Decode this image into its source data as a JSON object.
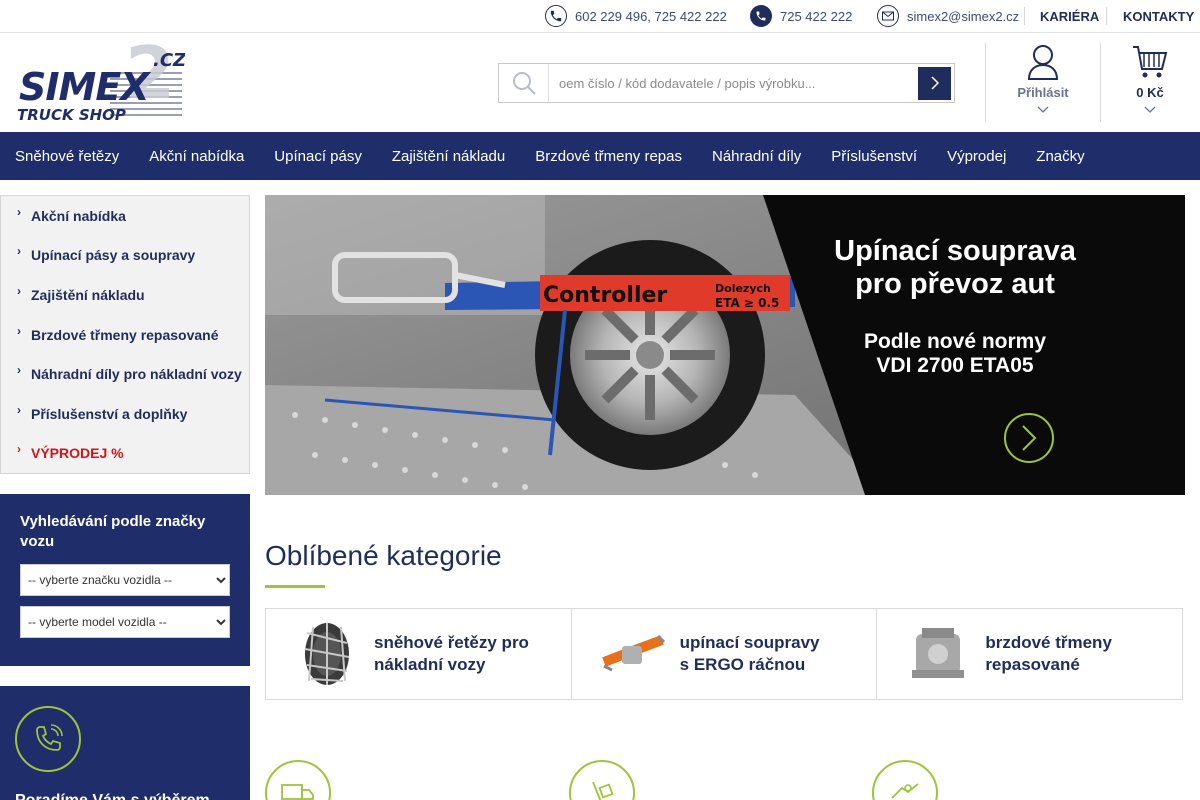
{
  "topbar": {
    "phones": "602 229 496, 725 422 222",
    "whatsapp": "725 422 222",
    "email": "simex2@simex2.cz",
    "links": [
      "KARIÉRA",
      "KONTAKTY"
    ],
    "icons": [
      "phone-icon",
      "whatsapp-icon",
      "mail-icon"
    ]
  },
  "header": {
    "logo_main": "SIMEX",
    "logo_tld": ".CZ",
    "logo_sub": "TRUCK SHOP",
    "logo_num": "2",
    "search_placeholder": "oem číslo / kód dodavatele / popis výrobku...",
    "login_label": "Přihlásit",
    "cart_label": "0 Kč"
  },
  "nav": {
    "items": [
      "Sněhové řetězy",
      "Akční nabídka",
      "Upínací pásy",
      "Zajištění nákladu",
      "Brzdové třmeny repas",
      "Náhradní díly",
      "Příslušenství",
      "Výprodej",
      "Značky"
    ]
  },
  "sidebar": {
    "categories": [
      "Akční nabídka",
      "Upínací pásy a soupravy",
      "Zajištění nákladu",
      "Brzdové třmeny repasované",
      "Náhradní díly pro nákladní vozy",
      "Příslušenství a doplňky",
      "VÝPRODEJ %"
    ],
    "vehicle_search": {
      "title": "Vyhledávání podle značky vozu",
      "make_placeholder": "-- vyberte značku vozidla --",
      "model_placeholder": "-- vyberte model vozidla --"
    },
    "contact_text": "Poradíme Vám s výběrem"
  },
  "banner": {
    "heading_line1": "Upínací souprava",
    "heading_line2": "pro převoz aut",
    "sub_line1": "Podle nové normy",
    "sub_line2": "VDI 2700 ETA05",
    "strap_label": "Controller",
    "brand_label": "Dolezych",
    "eta_label": "ETA ≥ 0.5"
  },
  "popular": {
    "title": "Oblíbené kategorie",
    "cards": [
      {
        "line1": "sněhové řetězy pro",
        "line2": "nákladní vozy",
        "icon": "snow-chain-image"
      },
      {
        "line1": "upínací soupravy",
        "line2": "s ERGO ráčnou",
        "icon": "ratchet-strap-image"
      },
      {
        "line1": "brzdové třmeny",
        "line2": "repasované",
        "icon": "brake-caliper-image"
      }
    ]
  },
  "colors": {
    "navy": "#1f2d6b",
    "accent_green": "#9ec43a",
    "sale_red": "#d4141b"
  }
}
